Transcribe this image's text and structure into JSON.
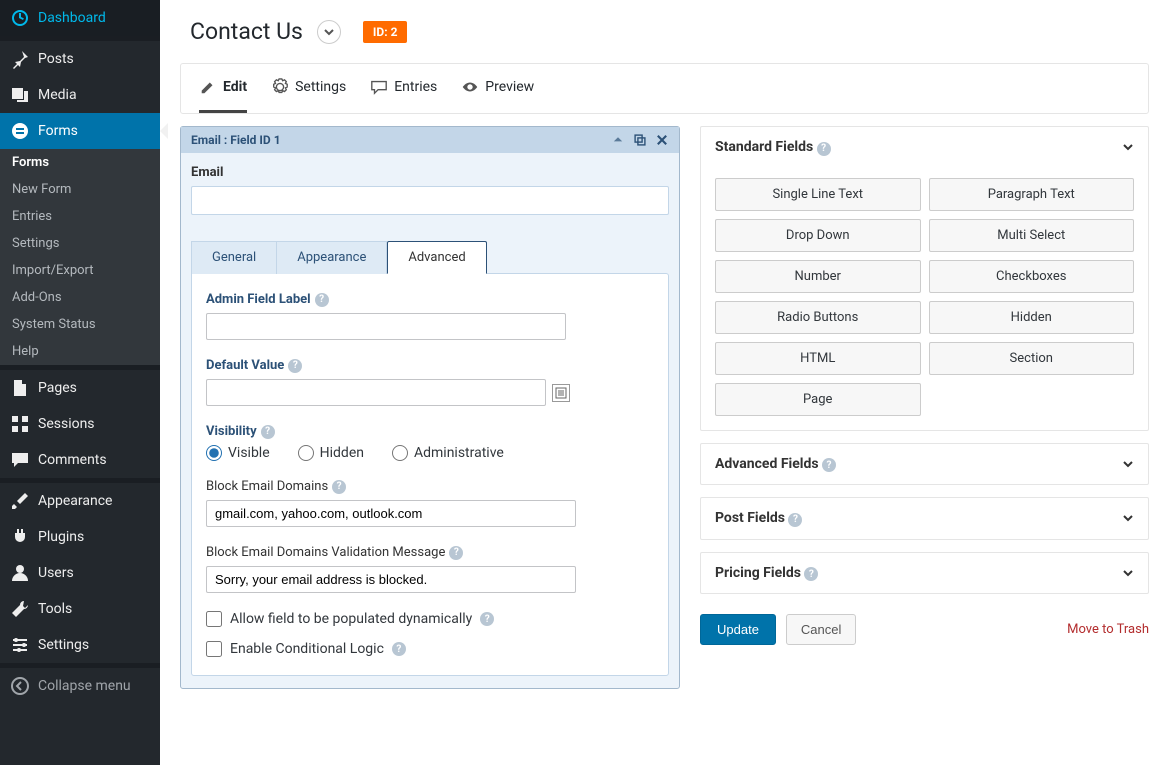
{
  "sidebar": {
    "dashboard": "Dashboard",
    "posts": "Posts",
    "media": "Media",
    "forms": "Forms",
    "forms_sub": [
      "Forms",
      "New Form",
      "Entries",
      "Settings",
      "Import/Export",
      "Add-Ons",
      "System Status",
      "Help"
    ],
    "pages": "Pages",
    "sessions": "Sessions",
    "comments": "Comments",
    "appearance": "Appearance",
    "plugins": "Plugins",
    "users": "Users",
    "tools": "Tools",
    "settings": "Settings",
    "collapse": "Collapse menu"
  },
  "page": {
    "title": "Contact Us",
    "id_badge": "ID: 2"
  },
  "tabs": {
    "edit": "Edit",
    "settings": "Settings",
    "entries": "Entries",
    "preview": "Preview"
  },
  "field": {
    "header": "Email : Field ID 1",
    "label": "Email",
    "value": "",
    "inner_tabs": {
      "general": "General",
      "appearance": "Appearance",
      "advanced": "Advanced"
    },
    "admin_label": "Admin Field Label",
    "admin_label_value": "",
    "default_value": "Default Value",
    "default_value_value": "",
    "visibility": "Visibility",
    "vis_visible": "Visible",
    "vis_hidden": "Hidden",
    "vis_admin": "Administrative",
    "block_domains": "Block Email Domains",
    "block_domains_value": "gmail.com, yahoo.com, outlook.com",
    "block_msg": "Block Email Domains Validation Message",
    "block_msg_value": "Sorry, your email address is blocked.",
    "dynamic": "Allow field to be populated dynamically",
    "conditional": "Enable Conditional Logic"
  },
  "panels": {
    "standard": "Standard Fields",
    "advanced": "Advanced Fields",
    "post": "Post Fields",
    "pricing": "Pricing Fields",
    "std_fields": [
      "Single Line Text",
      "Paragraph Text",
      "Drop Down",
      "Multi Select",
      "Number",
      "Checkboxes",
      "Radio Buttons",
      "Hidden",
      "HTML",
      "Section",
      "Page"
    ]
  },
  "actions": {
    "update": "Update",
    "cancel": "Cancel",
    "trash": "Move to Trash"
  }
}
